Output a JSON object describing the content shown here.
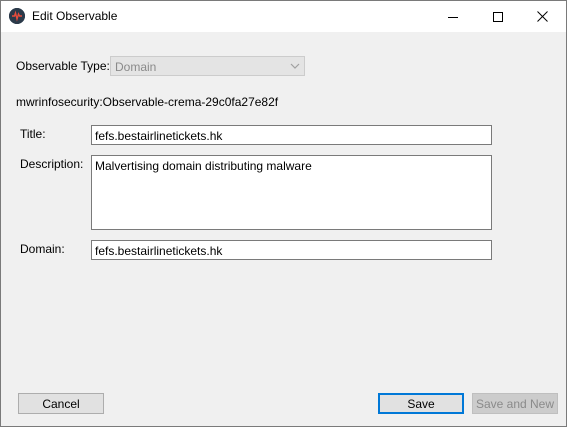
{
  "window": {
    "title": "Edit Observable"
  },
  "form": {
    "observable_type_label": "Observable Type:",
    "observable_type_value": "Domain",
    "observable_id": "mwrinfosecurity:Observable-crema-29c0fa27e82f",
    "title_label": "Title:",
    "title_value": "fefs.bestairlinetickets.hk",
    "description_label": "Description:",
    "description_value": "Malvertising domain distributing malware",
    "domain_label": "Domain:",
    "domain_value": "fefs.bestairlinetickets.hk"
  },
  "buttons": {
    "cancel": "Cancel",
    "save": "Save",
    "save_and_new": "Save and New"
  },
  "colors": {
    "accent": "#0078d7",
    "window_bg": "#f0f0f0",
    "disabled_text": "#8a8a8a"
  },
  "icons": {
    "app": "app-icon",
    "minimize": "minimize-icon",
    "maximize": "maximize-icon",
    "close": "close-icon",
    "dropdown": "chevron-down-icon"
  }
}
